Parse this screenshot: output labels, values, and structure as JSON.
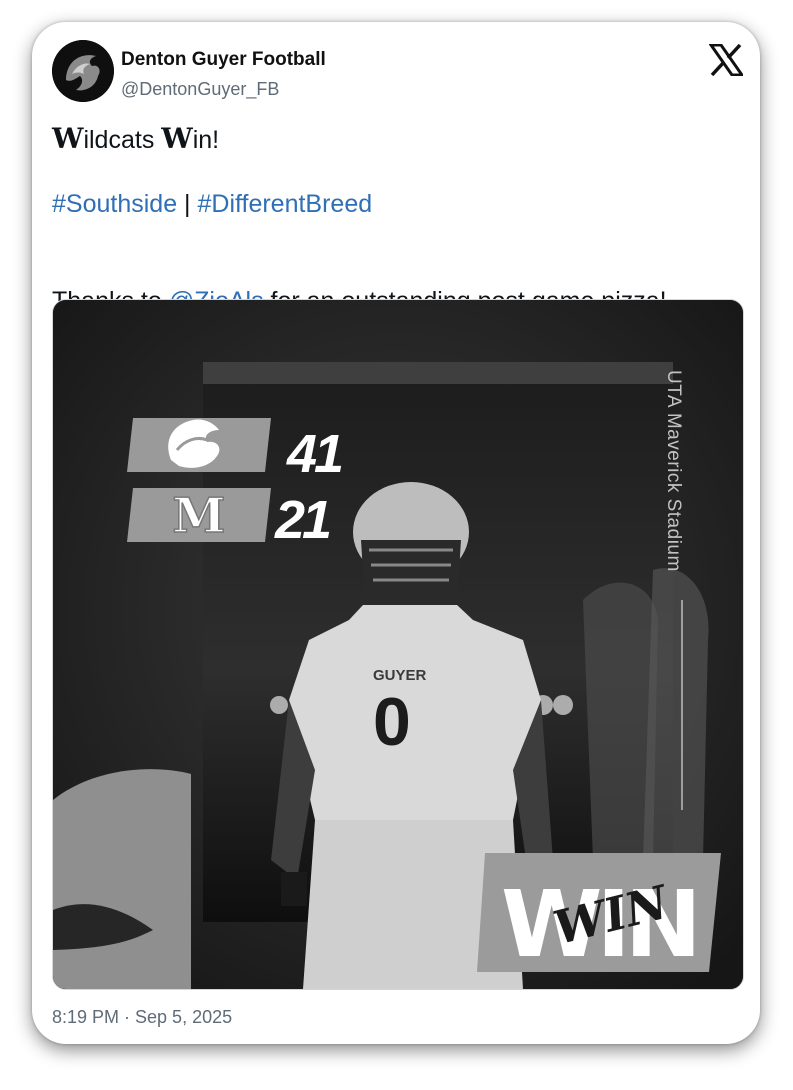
{
  "account": {
    "name": "Denton Guyer Football",
    "handle": "@DentonGuyer_FB",
    "avatar_icon": "wildcat-logo-icon"
  },
  "brand_icon": "x-logo-icon",
  "tweet": {
    "line1_cap1": "W",
    "line1_mid": "ildcats ",
    "line1_cap2": "W",
    "line1_end": "in!",
    "hashtag1": "#Southside",
    "separator": " | ",
    "hashtag2": "#DifferentBreed",
    "line3_start": "Thanks to ",
    "mention": "@ZioAls",
    "line3_end": " for an outstanding post game pizza!"
  },
  "media": {
    "home_score": "41",
    "away_score": "21",
    "stadium": "UTA Maverick Stadium",
    "jersey_text": "GUYER",
    "jersey_number": "0",
    "result_big": "WIN",
    "result_script": "WIN"
  },
  "timestamp": "8:19 PM · Sep 5, 2025",
  "colors": {
    "link": "#2f6fb5",
    "text": "#0f1419",
    "muted": "#5f6b76"
  }
}
